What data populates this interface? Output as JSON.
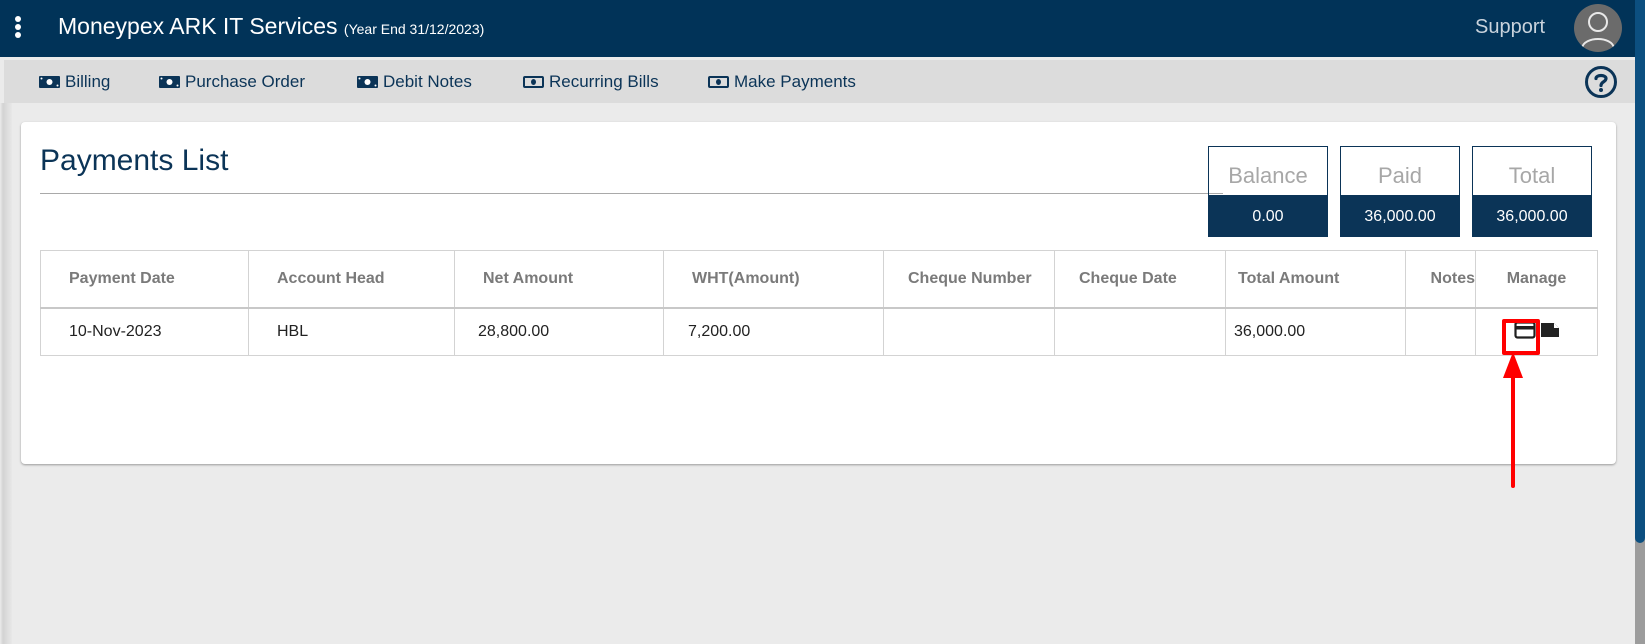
{
  "header": {
    "app_title": "Moneypex ARK IT Services",
    "year_end": "(Year End 31/12/2023)",
    "support_label": "Support",
    "menu_icon": "kebab-menu-icon",
    "avatar_icon": "user-avatar-icon"
  },
  "nav": {
    "items": [
      {
        "label": "Billing",
        "icon": "money-bill-icon"
      },
      {
        "label": "Purchase Order",
        "icon": "money-bill-icon"
      },
      {
        "label": "Debit Notes",
        "icon": "money-bill-icon"
      },
      {
        "label": "Recurring Bills",
        "icon": "money-bill-outline-icon"
      },
      {
        "label": "Make Payments",
        "icon": "money-bill-outline-icon"
      }
    ],
    "help_icon": "question-circle-icon"
  },
  "page": {
    "title": "Payments List"
  },
  "summary": [
    {
      "label": "Balance",
      "value": "0.00"
    },
    {
      "label": "Paid",
      "value": "36,000.00"
    },
    {
      "label": "Total",
      "value": "36,000.00"
    }
  ],
  "table": {
    "columns": [
      "Payment Date",
      "Account Head",
      "Net Amount",
      "WHT(Amount)",
      "Cheque Number",
      "Cheque Date",
      "Total Amount",
      "Notes",
      "Manage"
    ],
    "rows": [
      {
        "payment_date": "10-Nov-2023",
        "account_head": "HBL",
        "net_amount": "28,800.00",
        "wht_amount": "7,200.00",
        "cheque_number": "",
        "cheque_date": "",
        "total_amount": "36,000.00",
        "notes": "",
        "actions": [
          "credit-card-icon",
          "file-icon"
        ]
      }
    ]
  },
  "annotation": {
    "highlight_color": "#ff0000",
    "target": "credit-card-icon"
  },
  "colors": {
    "brand_dark": "#013358",
    "accent_navy": "#0b3457",
    "nav_bg": "#dcdcdc",
    "page_bg": "#ebebeb"
  }
}
